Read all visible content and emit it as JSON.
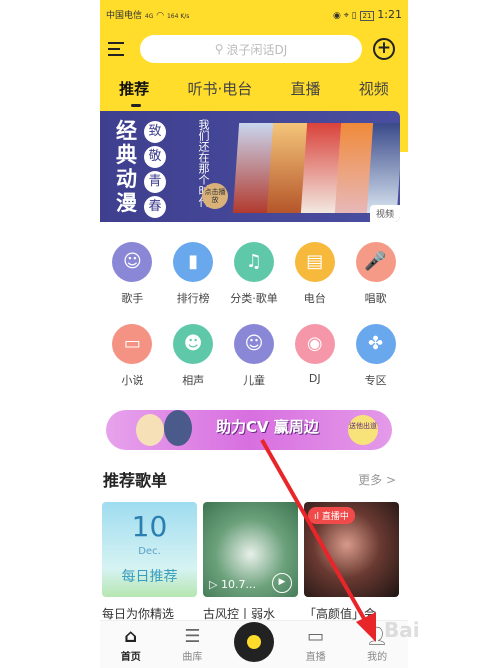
{
  "status": {
    "carrier": "中国电信",
    "signal": "4G",
    "speed": "164 K/s",
    "battery": "21",
    "time": "1:21"
  },
  "search": {
    "placeholder": "浪子闲话DJ"
  },
  "tabs": [
    {
      "label": "推荐",
      "active": true
    },
    {
      "label": "听书·电台"
    },
    {
      "label": "直播"
    },
    {
      "label": "视频"
    }
  ],
  "banner": {
    "title": "经典动漫",
    "circles": [
      "致",
      "敬",
      "青",
      "春"
    ],
    "verse": "我们还在那个时代",
    "play": "点击播放",
    "tag": "视频"
  },
  "categories": [
    [
      {
        "label": "歌手",
        "icon": "singer-icon",
        "color": "#8a88d6",
        "glyph": "☺"
      },
      {
        "label": "排行榜",
        "icon": "chart-icon",
        "color": "#6aa8ee",
        "glyph": "▮"
      },
      {
        "label": "分类·歌单",
        "icon": "music-list-icon",
        "color": "#5fc8a8",
        "glyph": "♫"
      },
      {
        "label": "电台",
        "icon": "radio-icon",
        "color": "#f7b93b",
        "glyph": "▤"
      },
      {
        "label": "唱歌",
        "icon": "microphone-icon",
        "color": "#f59a86",
        "glyph": "🎤"
      }
    ],
    [
      {
        "label": "小说",
        "icon": "book-icon",
        "color": "#f49283",
        "glyph": "▭"
      },
      {
        "label": "相声",
        "icon": "mask-icon",
        "color": "#5fc8a8",
        "glyph": "☻"
      },
      {
        "label": "儿童",
        "icon": "baby-icon",
        "color": "#8a88d6",
        "glyph": "☺"
      },
      {
        "label": "DJ",
        "icon": "turntable-icon",
        "color": "#f597a8",
        "glyph": "◉"
      },
      {
        "label": "专区",
        "icon": "grid-icon",
        "color": "#6aa8ee",
        "glyph": "✤"
      }
    ]
  ],
  "promo": {
    "text": "助力CV 赢周边",
    "button": "送他出道"
  },
  "playlists": {
    "title": "推荐歌单",
    "more": "更多 >",
    "items": [
      {
        "caption": "每日为你精选",
        "day": "10",
        "month": "Dec.",
        "label": "每日推荐"
      },
      {
        "caption": "古风控丨弱水",
        "plays": "▷ 10.7..."
      },
      {
        "caption": "「高颜值」会",
        "badge": "直播中"
      }
    ]
  },
  "nav": [
    {
      "label": "首页",
      "icon": "home-icon",
      "active": true
    },
    {
      "label": "曲库",
      "icon": "library-icon"
    },
    {
      "label": "",
      "icon": "player-disc-icon"
    },
    {
      "label": "直播",
      "icon": "video-camera-icon"
    },
    {
      "label": "我的",
      "icon": "user-icon"
    }
  ],
  "watermark": "Bai"
}
